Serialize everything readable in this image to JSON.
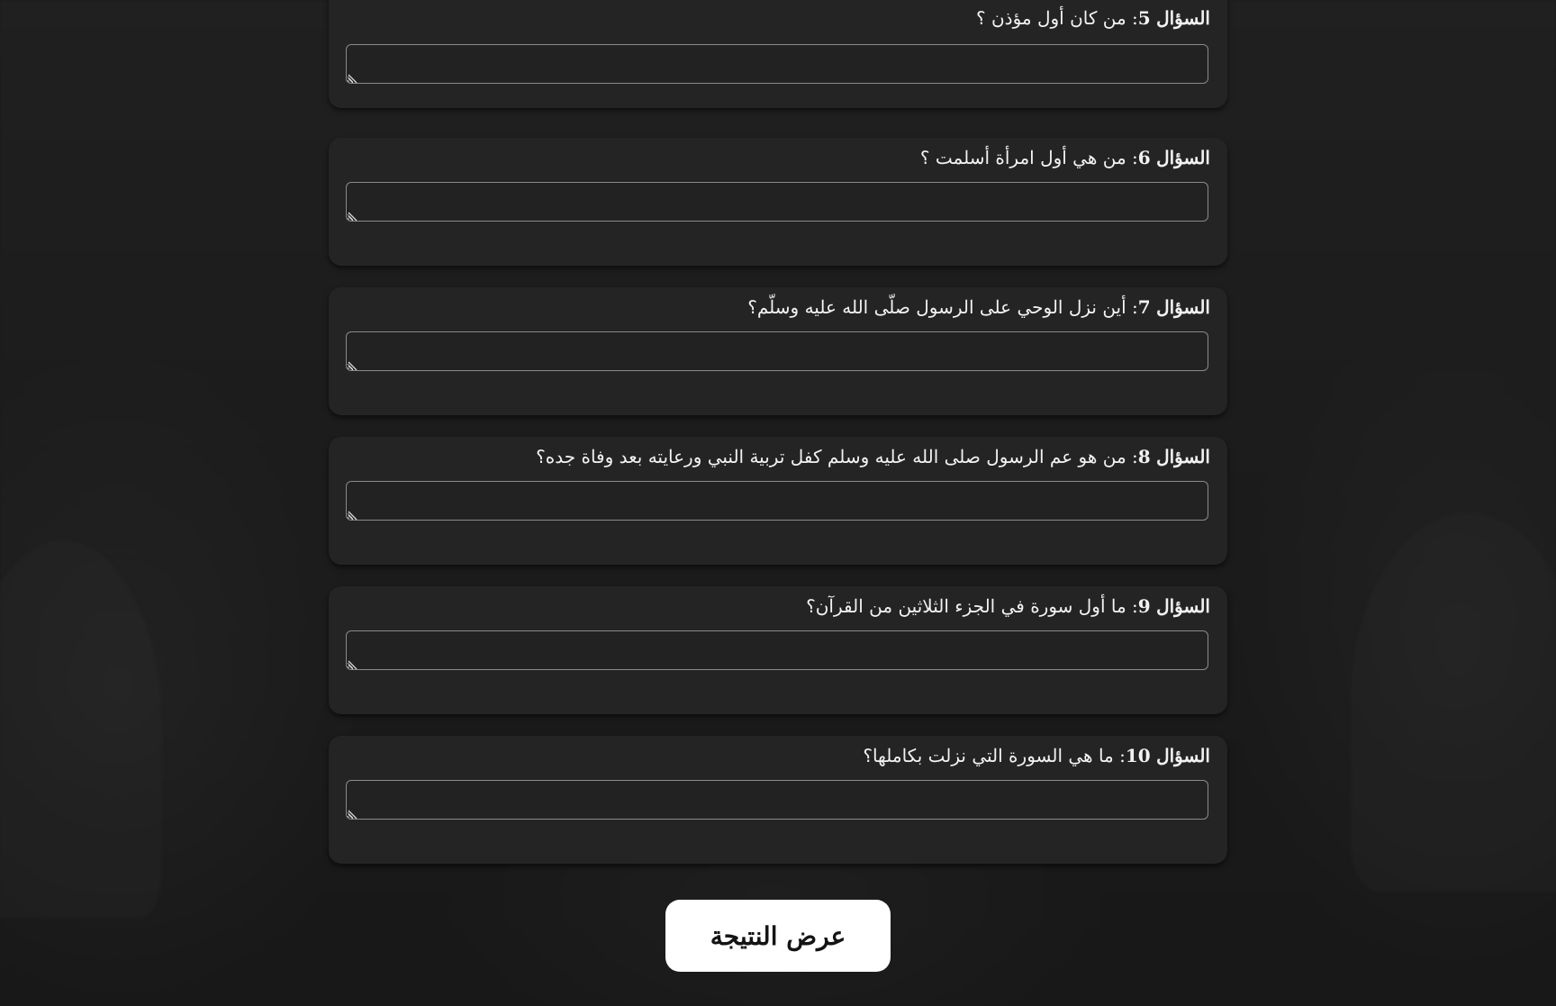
{
  "questions": [
    {
      "label": "السؤال",
      "number": "5",
      "sep": ":",
      "text": "من كان أول مؤذن ؟",
      "answer": ""
    },
    {
      "label": "السؤال",
      "number": "6",
      "sep": ":",
      "text": "من هي أول امرأة أسلمت ؟",
      "answer": ""
    },
    {
      "label": "السؤال",
      "number": "7",
      "sep": ":",
      "text": "أين نزل الوحي على الرسول صلّى الله عليه وسلّم؟",
      "answer": ""
    },
    {
      "label": "السؤال",
      "number": "8",
      "sep": ":",
      "text": "من هو عم الرسول صلى الله عليه وسلم كفل تربية النبي ورعايته بعد وفاة جده؟",
      "answer": ""
    },
    {
      "label": "السؤال",
      "number": "9",
      "sep": ":",
      "text": "ما أول سورة في الجزء الثلاثين من القرآن؟",
      "answer": ""
    },
    {
      "label": "السؤال",
      "number": "10",
      "sep": ":",
      "text": "ما هي السورة التي نزلت بكاملها؟",
      "answer": ""
    }
  ],
  "submit": {
    "label": "عرض النتيجة"
  }
}
